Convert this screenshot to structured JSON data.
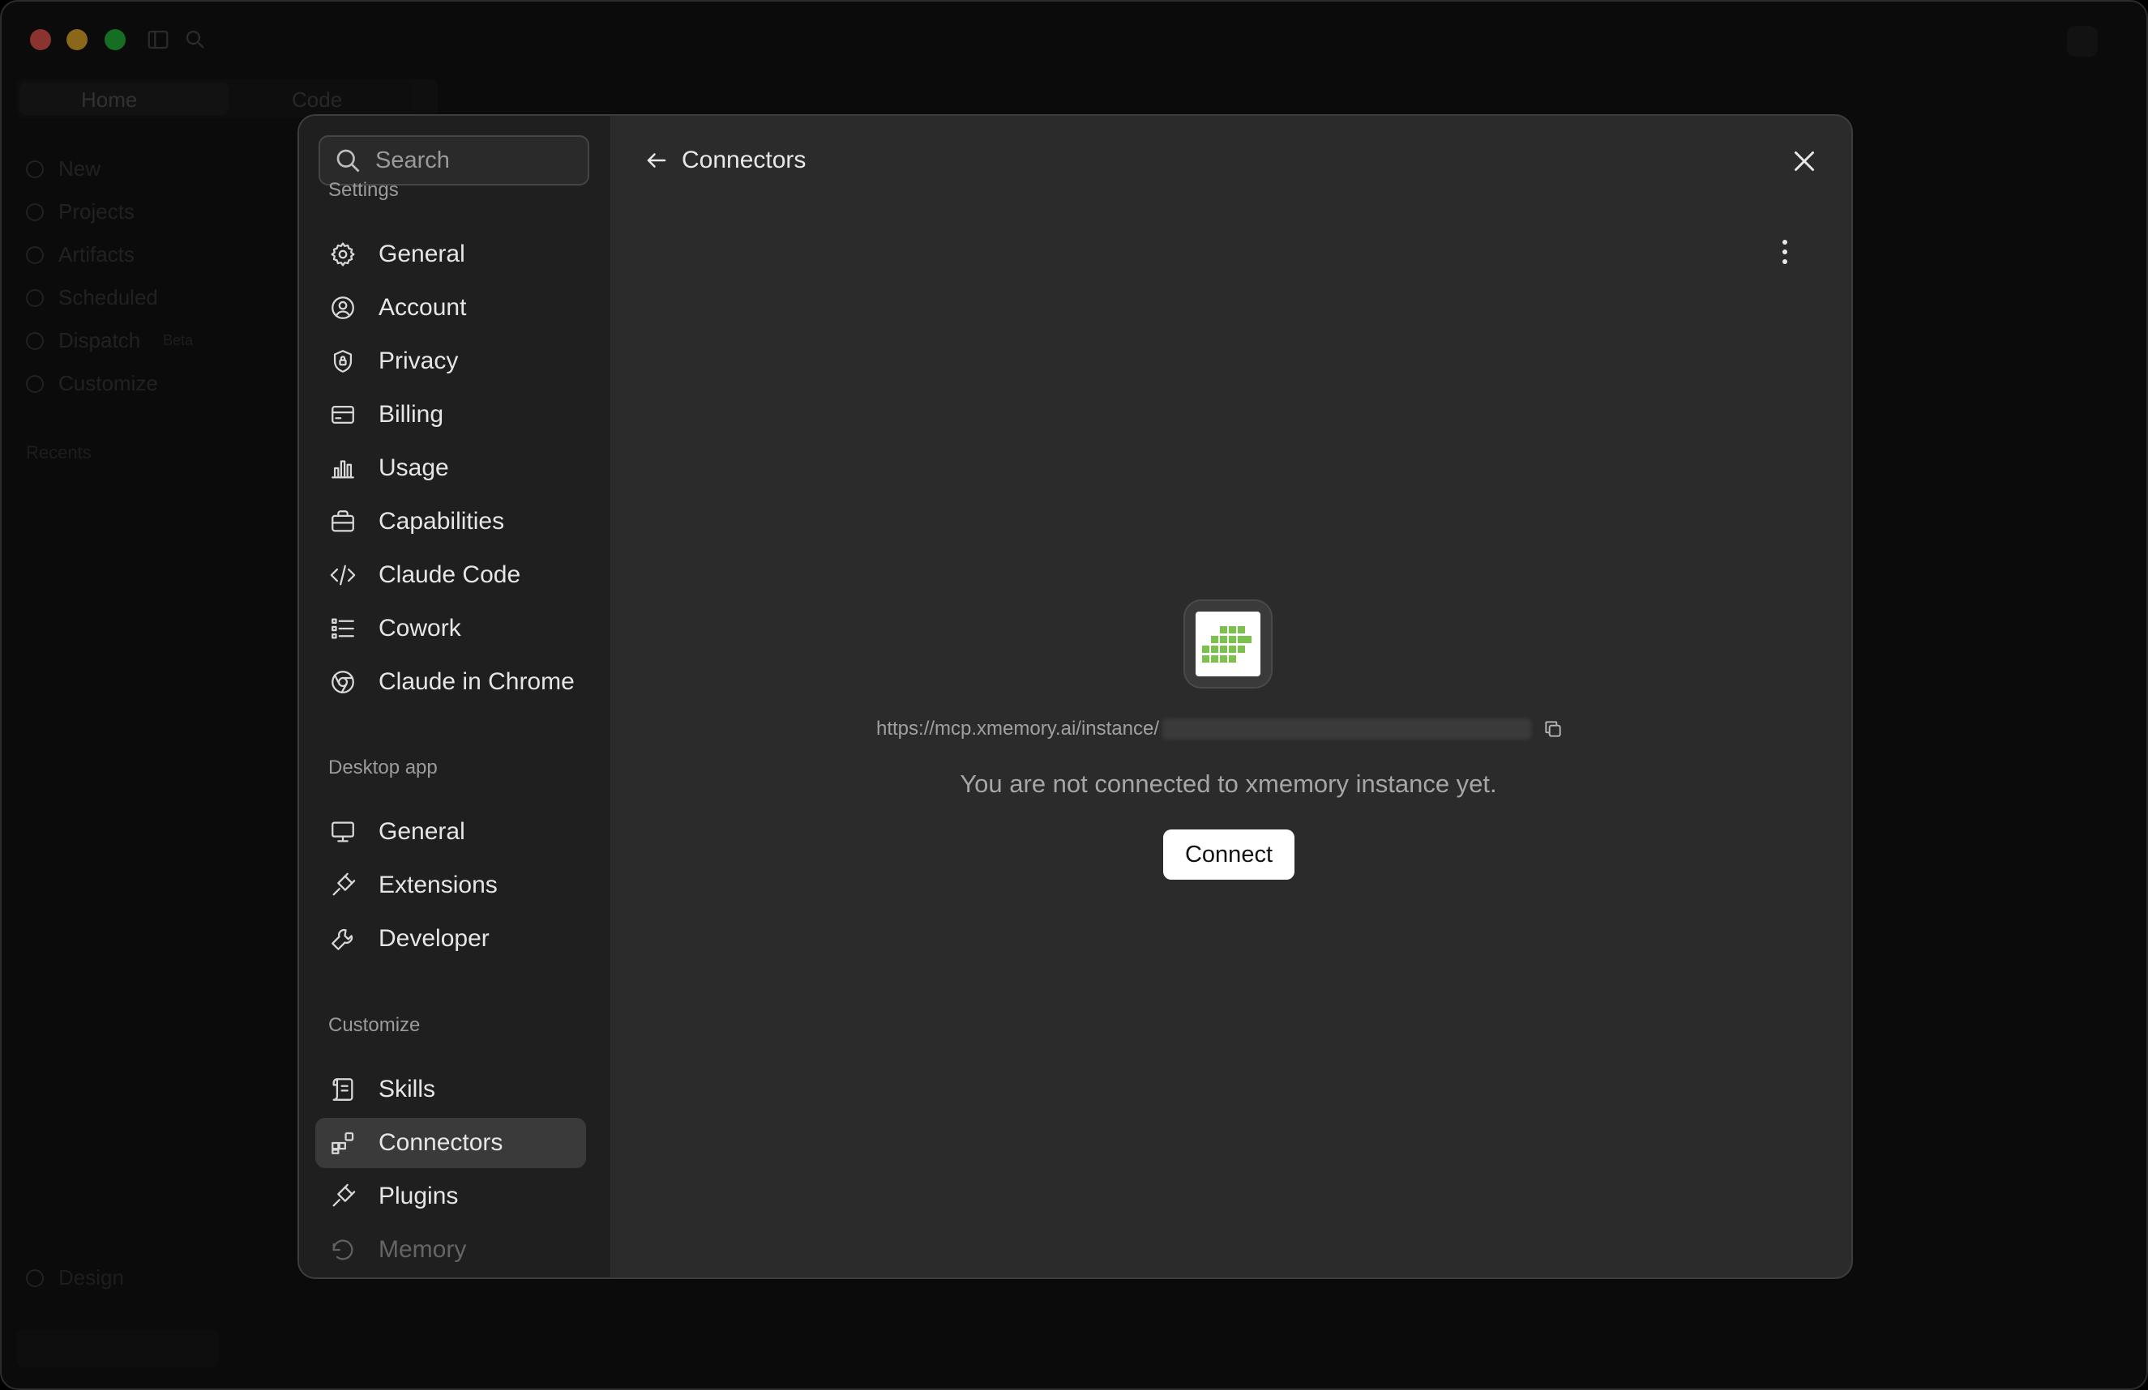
{
  "background_app": {
    "tabs": [
      "Home",
      "Code"
    ],
    "nav": [
      "New",
      "Projects",
      "Artifacts",
      "Scheduled",
      "Dispatch",
      "Customize"
    ],
    "dispatch_badge": "Beta",
    "recents_label": "Recents",
    "footer_item": "Design"
  },
  "search": {
    "placeholder": "Search"
  },
  "sidebar": {
    "sections": [
      {
        "label": "Settings",
        "items": [
          "General",
          "Account",
          "Privacy",
          "Billing",
          "Usage",
          "Capabilities",
          "Claude Code",
          "Cowork",
          "Claude in Chrome"
        ]
      },
      {
        "label": "Desktop app",
        "items": [
          "General",
          "Extensions",
          "Developer"
        ]
      },
      {
        "label": "Customize",
        "items": [
          "Skills",
          "Connectors",
          "Plugins",
          "Memory"
        ]
      }
    ],
    "active_item": "Connectors"
  },
  "header": {
    "back_label": "Connectors"
  },
  "connector": {
    "url": "https://mcp.xmemory.ai/instance/",
    "status": "You are not connected to xmemory instance yet.",
    "connect_label": "Connect",
    "logo_color": "#7cc14e"
  }
}
